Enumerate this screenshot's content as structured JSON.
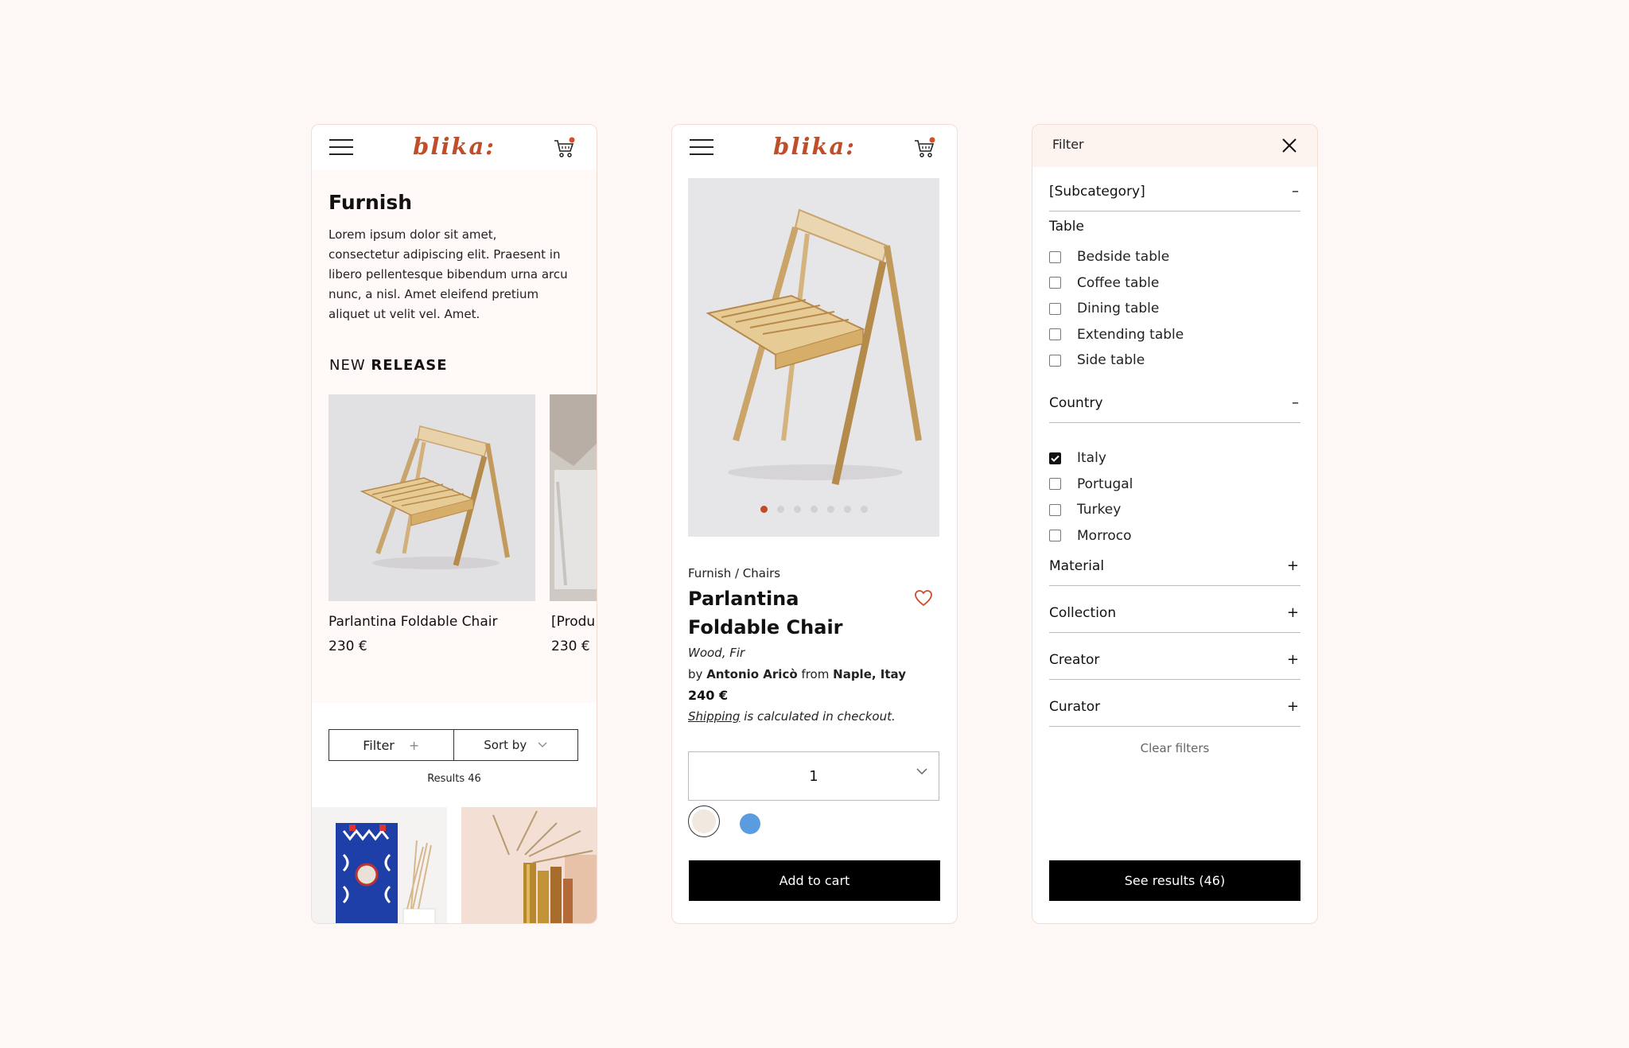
{
  "brand": {
    "logo": "blika:",
    "accent": "#bf4e2a"
  },
  "screen1": {
    "title": "Furnish",
    "description": "Lorem ipsum dolor sit amet, consectetur adipiscing elit. Praesent in libero pellentesque bibendum urna arcu nunc, a nisl. Amet eleifend pretium aliquet ut velit vel. Amet.",
    "new_release_prefix": "NEW",
    "new_release_bold": "RELEASE",
    "products": [
      {
        "name": "Parlantina Foldable Chair",
        "price": "230 €"
      },
      {
        "name": "[Produ",
        "price": "230 €"
      }
    ],
    "filter_label": "Filter",
    "sort_label": "Sort by",
    "results": "Results 46"
  },
  "screen2": {
    "breadcrumb": "Furnish / Chairs",
    "title": "Parlantina Foldable Chair",
    "material": "Wood, Fir",
    "by_prefix": "by",
    "creator": "Antonio Aricò",
    "from_prefix": "from",
    "origin": "Naple, Itay",
    "price": "240 €",
    "shipping_link": "Shipping",
    "shipping_rest": " is calculated in checkout.",
    "quantity": "1",
    "slide_count": 7,
    "active_slide": 1,
    "swatches": [
      "#f1e8df",
      "#5b9be0"
    ],
    "add_to_cart": "Add to cart"
  },
  "screen3": {
    "header": "Filter",
    "subcategory": "[Subcategory]",
    "group_label": "Table",
    "table_options": [
      "Bedside table",
      "Coffee table",
      "Dining table",
      "Extending table",
      "Side table"
    ],
    "country_label": "Country",
    "country_options": [
      {
        "label": "Italy",
        "checked": true
      },
      {
        "label": "Portugal",
        "checked": false
      },
      {
        "label": "Turkey",
        "checked": false
      },
      {
        "label": "Morroco",
        "checked": false
      }
    ],
    "collapsed_sections": [
      "Material",
      "Collection",
      "Creator",
      "Curator"
    ],
    "expanded_sign": "–",
    "collapsed_sign": "+",
    "clear_filters": "Clear filters",
    "see_results": "See results (46)"
  }
}
